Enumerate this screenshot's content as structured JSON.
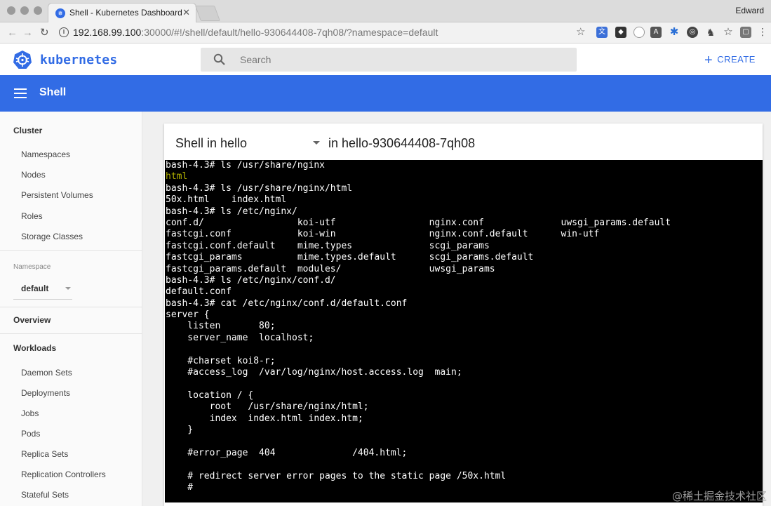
{
  "browser": {
    "tab_title": "Shell - Kubernetes Dashboard",
    "profile_name": "Edward",
    "url_host": "192.168.99.100",
    "url_rest": ":30000/#!/shell/default/hello-930644408-7qh08/?namespace=default"
  },
  "header": {
    "brand": "kubernetes",
    "search_placeholder": "Search",
    "create_label": "CREATE",
    "accent_color": "#326ce5"
  },
  "titlebar": {
    "title": "Shell"
  },
  "sidebar": {
    "cluster_heading": "Cluster",
    "cluster_items": [
      {
        "label": "Namespaces"
      },
      {
        "label": "Nodes"
      },
      {
        "label": "Persistent Volumes"
      },
      {
        "label": "Roles"
      },
      {
        "label": "Storage Classes"
      }
    ],
    "namespace_label": "Namespace",
    "namespace_value": "default",
    "overview_label": "Overview",
    "workloads_heading": "Workloads",
    "workload_items": [
      {
        "label": "Daemon Sets"
      },
      {
        "label": "Deployments"
      },
      {
        "label": "Jobs"
      },
      {
        "label": "Pods"
      },
      {
        "label": "Replica Sets"
      },
      {
        "label": "Replication Controllers"
      },
      {
        "label": "Stateful Sets"
      }
    ]
  },
  "shell": {
    "container_label": "Shell in hello",
    "pod_label": "in hello-930644408-7qh08",
    "terminal_lines": [
      "bash-4.3# ls /usr/share/nginx",
      "html",
      "bash-4.3# ls /usr/share/nginx/html",
      "50x.html    index.html",
      "bash-4.3# ls /etc/nginx/",
      "conf.d/                 koi-utf                 nginx.conf              uwsgi_params.default",
      "fastcgi.conf            koi-win                 nginx.conf.default      win-utf",
      "fastcgi.conf.default    mime.types              scgi_params",
      "fastcgi_params          mime.types.default      scgi_params.default",
      "fastcgi_params.default  modules/                uwsgi_params",
      "bash-4.3# ls /etc/nginx/conf.d/",
      "default.conf",
      "bash-4.3# cat /etc/nginx/conf.d/default.conf",
      "server {",
      "    listen       80;",
      "    server_name  localhost;",
      "",
      "    #charset koi8-r;",
      "    #access_log  /var/log/nginx/host.access.log  main;",
      "",
      "    location / {",
      "        root   /usr/share/nginx/html;",
      "        index  index.html index.htm;",
      "    }",
      "",
      "    #error_page  404              /404.html;",
      "",
      "    # redirect server error pages to the static page /50x.html",
      "    #"
    ]
  },
  "watermark": "@稀土掘金技术社区"
}
